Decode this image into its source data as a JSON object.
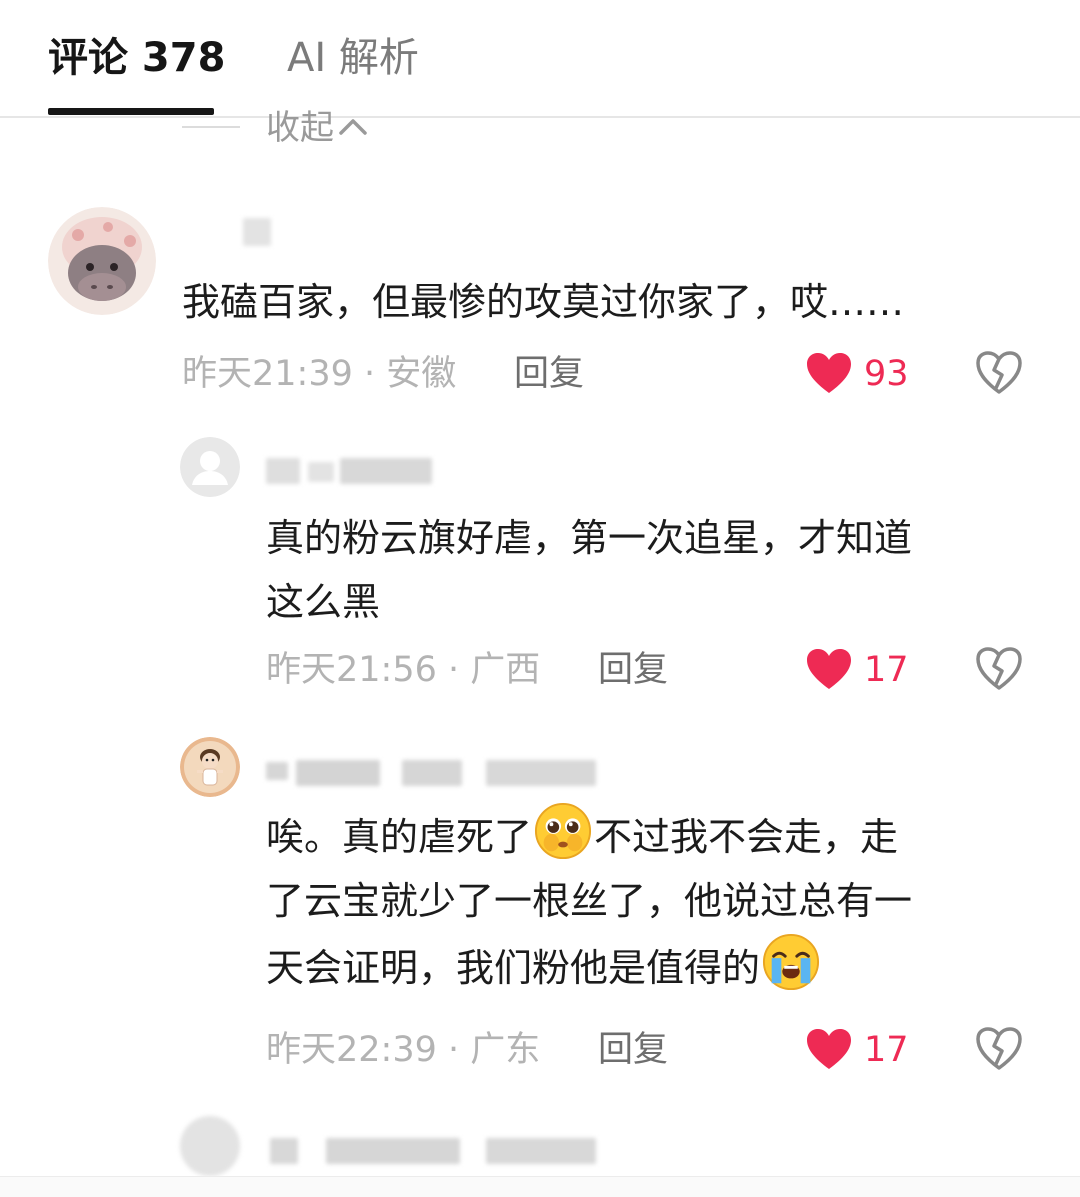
{
  "tabs": [
    {
      "label": "评论 378",
      "active": true
    },
    {
      "label": "AI 解析",
      "active": false
    }
  ],
  "collapse": {
    "label": "收起"
  },
  "colors": {
    "like": "#ee2a54",
    "meta": "#b3b3b3",
    "text": "#1c1c1c"
  },
  "comments": [
    {
      "avatar": "hippo-avatar",
      "text_lines": [
        "我磕百家，但最惨的攻莫过你家了，哎……"
      ],
      "meta": "昨天21:39 · 安徽",
      "reply_label": "回复",
      "likes": "93"
    },
    {
      "avatar": "default-user-avatar",
      "text_lines": [
        "真的粉云旗好虐，第一次追星，才知道",
        "这么黑"
      ],
      "meta": "昨天21:56 · 广西",
      "reply_label": "回复",
      "likes": "17"
    },
    {
      "avatar": "cartoon-child-avatar",
      "text_lines": [
        "唉。真的虐死了",
        "不过我不会走，走",
        "了云宝就少了一根丝了，他说过总有一",
        "天会证明，我们粉他是值得的"
      ],
      "emojis": [
        "pleading-face-emoji",
        "loudly-crying-face-emoji"
      ],
      "meta": "昨天22:39 · 广东",
      "reply_label": "回复",
      "likes": "17"
    }
  ]
}
